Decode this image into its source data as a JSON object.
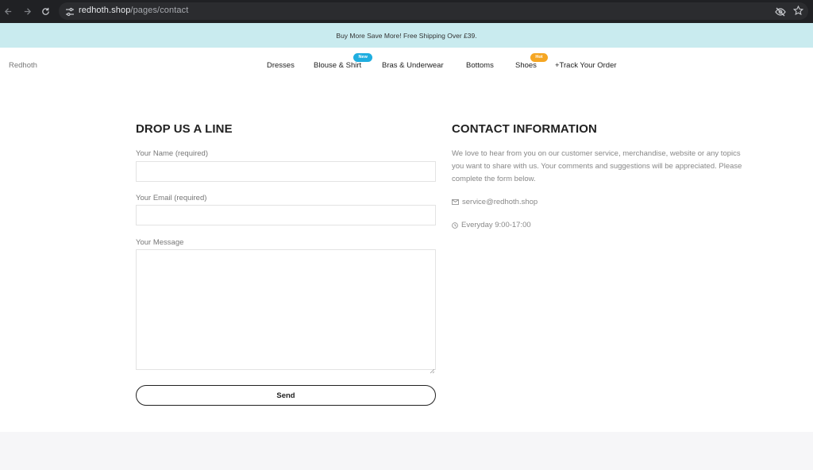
{
  "browser": {
    "url_host": "redhoth.shop",
    "url_path": "/pages/contact",
    "icons": {
      "back": "arrow-left-icon",
      "forward": "arrow-right-icon",
      "reload": "reload-icon",
      "site_info": "tune-icon",
      "tracking_protection": "eye-off-icon",
      "bookmark": "star-icon"
    }
  },
  "promo": {
    "text": "Buy More Save More! Free Shipping Over £39."
  },
  "header": {
    "logo": "Redhoth",
    "nav": [
      {
        "label": "Dresses"
      },
      {
        "label": "Blouse & Shirt",
        "badge": "New"
      },
      {
        "label": "Bras & Underwear"
      },
      {
        "label": "Bottoms"
      },
      {
        "label": "Shoes",
        "badge": "Hot"
      },
      {
        "label": "+Track Your Order"
      }
    ],
    "badge_colors": {
      "new": "#1faee0",
      "hot": "#f5a623"
    }
  },
  "form": {
    "title": "DROP US A LINE",
    "name_label": "Your Name (required)",
    "name_value": "",
    "email_label": "Your Email (required)",
    "email_value": "",
    "message_label": "Your Message",
    "message_value": "",
    "send_label": "Send"
  },
  "contact": {
    "title": "CONTACT INFORMATION",
    "description": "We love to hear from you on our customer service, merchandise, website or any topics you want to share with us. Your comments and suggestions will be appreciated. Please complete the form below.",
    "email": "service@redhoth.shop",
    "hours": "Everyday 9:00-17:00",
    "icons": {
      "email": "mail-icon",
      "hours": "clock-icon"
    }
  },
  "colors": {
    "promo_bg": "#c9ebef",
    "footer_bg": "#f6f6f8",
    "text_primary": "#222222",
    "text_muted": "#888888"
  }
}
